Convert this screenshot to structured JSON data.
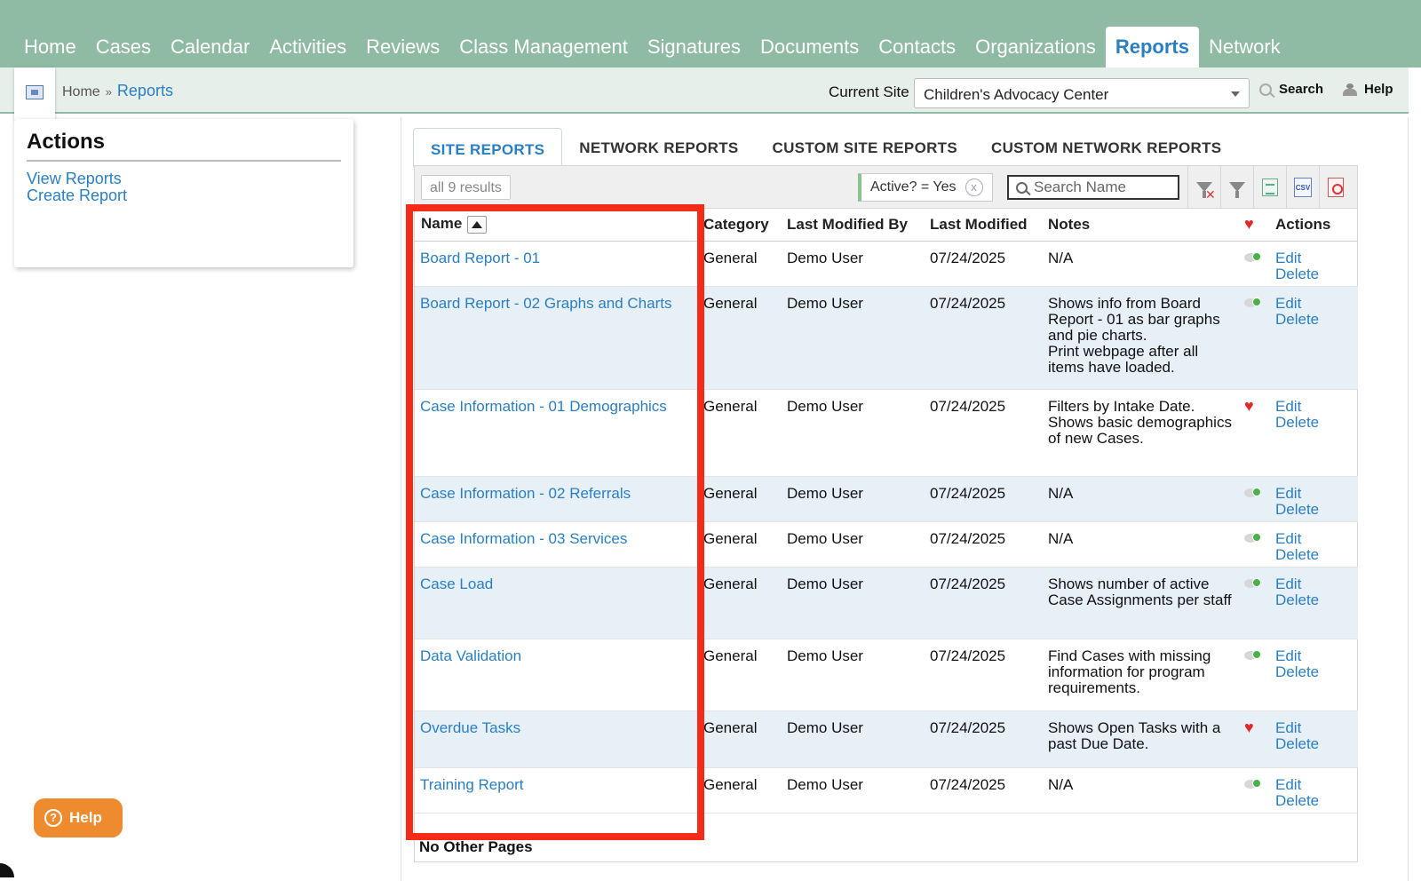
{
  "nav": {
    "items": [
      {
        "label": "Home",
        "active": false
      },
      {
        "label": "Cases",
        "active": false
      },
      {
        "label": "Calendar",
        "active": false
      },
      {
        "label": "Activities",
        "active": false
      },
      {
        "label": "Reviews",
        "active": false
      },
      {
        "label": "Class Management",
        "active": false
      },
      {
        "label": "Signatures",
        "active": false
      },
      {
        "label": "Documents",
        "active": false
      },
      {
        "label": "Contacts",
        "active": false
      },
      {
        "label": "Organizations",
        "active": false
      },
      {
        "label": "Reports",
        "active": true
      },
      {
        "label": "Network",
        "active": false
      }
    ]
  },
  "breadcrumb": {
    "home": "Home",
    "separator": "»",
    "current": "Reports"
  },
  "site": {
    "label": "Current Site",
    "value": "Children's Advocacy Center"
  },
  "header_actions": {
    "search": "Search",
    "help": "Help"
  },
  "actions_panel": {
    "title": "Actions",
    "links": [
      "View Reports",
      "Create Report"
    ]
  },
  "tabs": [
    {
      "label": "SITE REPORTS",
      "active": true
    },
    {
      "label": "NETWORK REPORTS",
      "active": false
    },
    {
      "label": "CUSTOM SITE REPORTS",
      "active": false
    },
    {
      "label": "CUSTOM NETWORK REPORTS",
      "active": false
    }
  ],
  "toolbar": {
    "results": "all 9 results",
    "filter_chip": "Active? = Yes",
    "filter_chip_remove": "x",
    "search_placeholder": "Search Name",
    "csv_label": "CSV"
  },
  "table": {
    "columns": {
      "name": "Name",
      "category": "Category",
      "modified_by": "Last Modified By",
      "modified": "Last Modified",
      "notes": "Notes",
      "favorite": "♥",
      "actions": "Actions"
    },
    "edit_label": "Edit",
    "delete_label": "Delete",
    "rows": [
      {
        "name": "Board Report - 01",
        "category": "General",
        "modified_by": "Demo User",
        "modified": "07/24/2025",
        "notes": "N/A",
        "favorite": false
      },
      {
        "name": "Board Report - 02 Graphs and Charts",
        "category": "General",
        "modified_by": "Demo User",
        "modified": "07/24/2025",
        "notes": "Shows info from Board Report - 01 as bar graphs and pie charts.\nPrint webpage after all items have loaded.",
        "favorite": false
      },
      {
        "name": "Case Information - 01 Demographics",
        "category": "General",
        "modified_by": "Demo User",
        "modified": "07/24/2025",
        "notes": "Filters by Intake Date. Shows basic demographics of new Cases.",
        "favorite": true
      },
      {
        "name": "Case Information - 02 Referrals",
        "category": "General",
        "modified_by": "Demo User",
        "modified": "07/24/2025",
        "notes": "N/A",
        "favorite": false
      },
      {
        "name": "Case Information - 03 Services",
        "category": "General",
        "modified_by": "Demo User",
        "modified": "07/24/2025",
        "notes": "N/A",
        "favorite": false
      },
      {
        "name": "Case Load",
        "category": "General",
        "modified_by": "Demo User",
        "modified": "07/24/2025",
        "notes": "Shows number of active Case Assignments per staff",
        "favorite": false
      },
      {
        "name": "Data Validation",
        "category": "General",
        "modified_by": "Demo User",
        "modified": "07/24/2025",
        "notes": "Find Cases with missing information for program requirements.",
        "favorite": false
      },
      {
        "name": "Overdue Tasks",
        "category": "General",
        "modified_by": "Demo User",
        "modified": "07/24/2025",
        "notes": "Shows Open Tasks with a past Due Date.",
        "favorite": true
      },
      {
        "name": "Training Report",
        "category": "General",
        "modified_by": "Demo User",
        "modified": "07/24/2025",
        "notes": "N/A",
        "favorite": false
      }
    ]
  },
  "pagination": "No Other Pages",
  "help_button": "Help",
  "colors": {
    "nav_bg": "#8fbaa3",
    "link": "#2a7fc0",
    "highlight": "#f52b19",
    "help_button": "#ef8b2f"
  }
}
